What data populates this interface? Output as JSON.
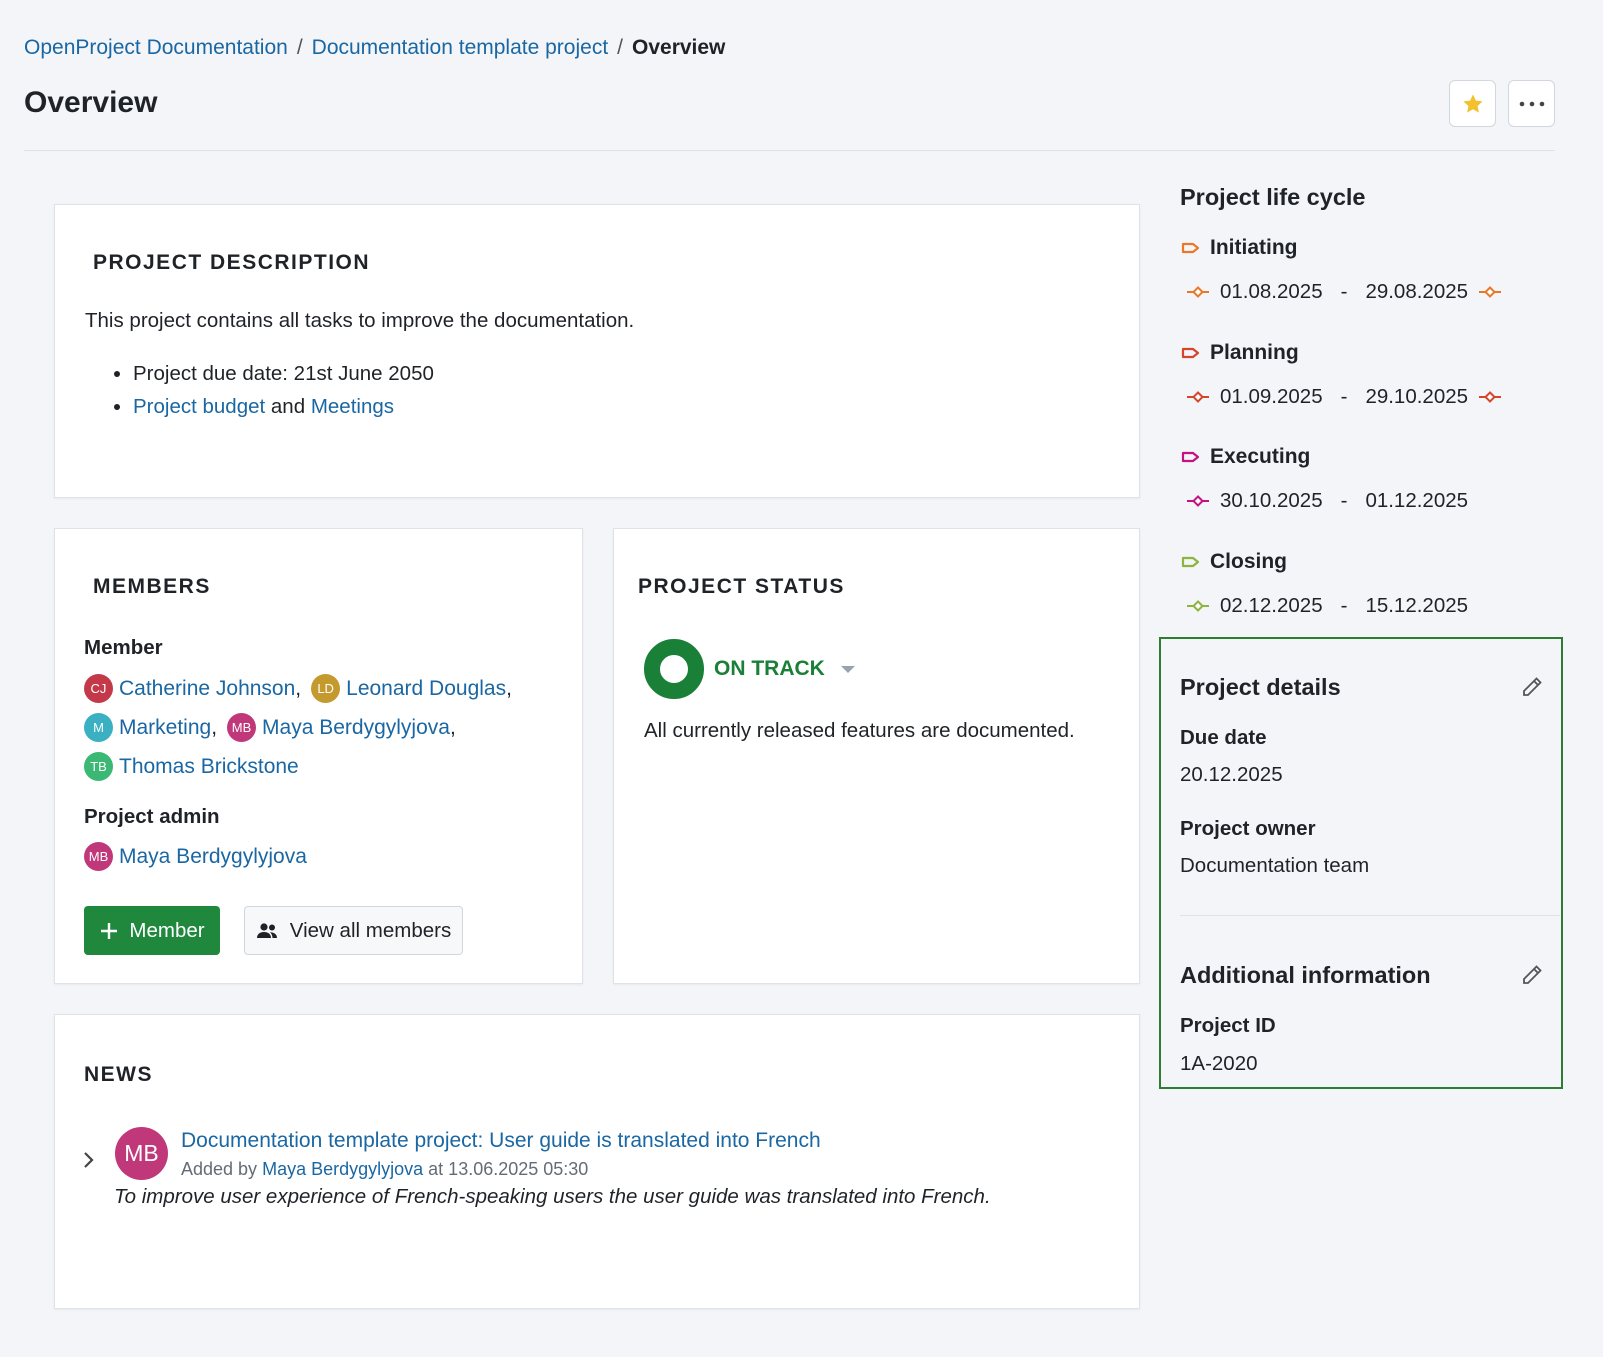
{
  "breadcrumb": {
    "items": [
      "OpenProject Documentation",
      "Documentation template project"
    ],
    "separator": "/",
    "current": "Overview"
  },
  "page": {
    "title": "Overview"
  },
  "header_actions": {
    "favorite_icon": "star-icon",
    "more_icon": "ellipsis-icon",
    "star_color": "#f2c12e"
  },
  "description": {
    "title": "PROJECT DESCRIPTION",
    "text": "This project contains all tasks to improve the documentation.",
    "bullet1": "Project due date: 21st June 2050",
    "link_budget": "Project budget",
    "and": "and",
    "link_meetings": "Meetings"
  },
  "members": {
    "title": "MEMBERS",
    "member_label": "Member",
    "list": [
      {
        "initials": "CJ",
        "name": "Catherine Johnson",
        "color": "#c4394a"
      },
      {
        "initials": "LD",
        "name": "Leonard Douglas",
        "color": "#c49a2e"
      },
      {
        "initials": "M",
        "name": "Marketing",
        "color": "#3ab0c2"
      },
      {
        "initials": "MB",
        "name": "Maya Berdygylyjova",
        "color": "#c0387a"
      },
      {
        "initials": "TB",
        "name": "Thomas Brickstone",
        "color": "#3bb873"
      }
    ],
    "comma": ",",
    "admin_label": "Project admin",
    "admin": {
      "initials": "MB",
      "name": "Maya Berdygylyjova",
      "color": "#c0387a"
    },
    "add_button": "Member",
    "view_all_button": "View all members"
  },
  "status": {
    "title": "PROJECT STATUS",
    "value": "ON TRACK",
    "color": "#1a7f37",
    "text": "All currently released features are documented."
  },
  "news": {
    "title": "NEWS",
    "author_initials": "MB",
    "headline": "Documentation template project: User guide is translated into French",
    "added_by": "Added by",
    "author": "Maya Berdygylyjova",
    "at": "at 13.06.2025 05:30",
    "summary": "To improve user experience of French-speaking users the user guide was translated into French."
  },
  "life_cycle": {
    "title": "Project life cycle",
    "separator": "-",
    "phases": [
      {
        "name": "Initiating",
        "start": "01.08.2025",
        "end": "29.08.2025",
        "color": "#e8792b",
        "end_gate": true
      },
      {
        "name": "Planning",
        "start": "01.09.2025",
        "end": "29.10.2025",
        "color": "#d6452b",
        "end_gate": true
      },
      {
        "name": "Executing",
        "start": "30.10.2025",
        "end": "01.12.2025",
        "color": "#c4127f",
        "end_gate": false
      },
      {
        "name": "Closing",
        "start": "02.12.2025",
        "end": "15.12.2025",
        "color": "#8db43c",
        "end_gate": false
      }
    ]
  },
  "project_details": {
    "title": "Project details",
    "due_date_label": "Due date",
    "due_date": "20.12.2025",
    "owner_label": "Project owner",
    "owner": "Documentation team"
  },
  "additional_info": {
    "title": "Additional information",
    "project_id_label": "Project ID",
    "project_id": "1A-2020"
  }
}
